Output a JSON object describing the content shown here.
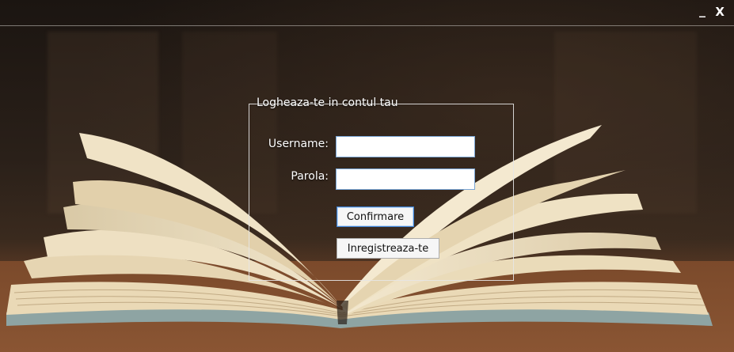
{
  "window": {
    "minimize_label": "_",
    "close_label": "X"
  },
  "login": {
    "legend": "Logheaza-te in contul tau",
    "username_label": "Username:",
    "username_value": "",
    "password_label": "Parola:",
    "password_value": "",
    "confirm_label": "Confirmare",
    "register_label": "Inregistreaza-te"
  },
  "colors": {
    "border_focus": "#7aa6d6",
    "button_face": "#f6f6f6",
    "text_light": "#ffffff"
  }
}
